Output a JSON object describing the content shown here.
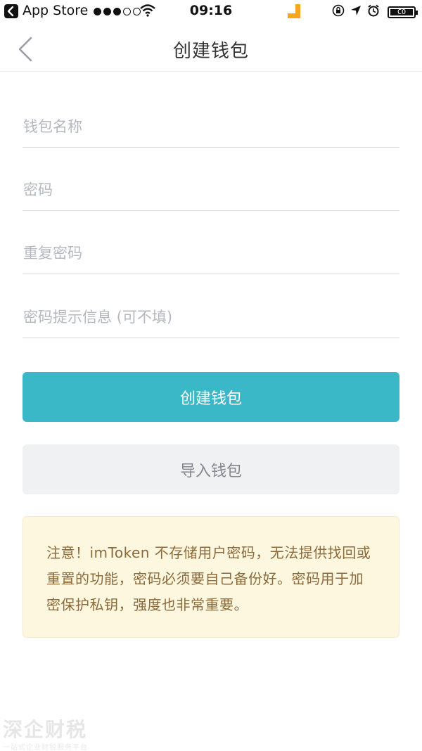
{
  "status_bar": {
    "back_app": "App Store",
    "time": "09:16",
    "battery_text": "CO"
  },
  "nav": {
    "title": "创建钱包"
  },
  "form": {
    "wallet_name_placeholder": "钱包名称",
    "password_placeholder": "密码",
    "repeat_password_placeholder": "重复密码",
    "hint_placeholder": "密码提示信息 (可不填)"
  },
  "buttons": {
    "create": "创建钱包",
    "import": "导入钱包"
  },
  "notice": {
    "text": "注意！imToken 不存储用户密码，无法提供找回或重置的功能，密码必须要自己备份好。密码用于加密保护私钥，强度也非常重要。"
  },
  "watermark": {
    "main": "深企财税",
    "sub": "一站式企业财税服务平台"
  },
  "colors": {
    "primary": "#3ab8c8",
    "secondary_bg": "#f0f1f3",
    "notice_bg": "#fef7df",
    "notice_text": "#8b6a3b",
    "placeholder": "#b4b8c0"
  }
}
